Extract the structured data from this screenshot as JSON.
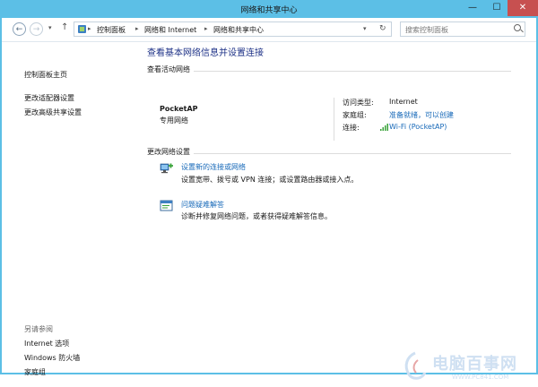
{
  "window": {
    "title": "网络和共享中心"
  },
  "controls": {
    "minimize": "—",
    "maximize": "☐",
    "close": "✕"
  },
  "navbar": {
    "back": "←",
    "forward": "→",
    "dropdown": "▾",
    "up": "↑",
    "breadcrumbs": [
      "控制面板",
      "网络和 Internet",
      "网络和共享中心"
    ],
    "separator": "▸",
    "refresh": "↻",
    "search_placeholder": "搜索控制面板"
  },
  "sidebar": {
    "links": [
      "控制面板主页",
      "更改适配器设置",
      "更改高级共享设置"
    ],
    "see_also_heading": "另请参阅",
    "see_also": [
      "Internet 选项",
      "Windows 防火墙",
      "家庭组"
    ]
  },
  "main": {
    "title": "查看基本网络信息并设置连接",
    "active_networks_heading": "查看活动网络",
    "network": {
      "name": "PocketAP",
      "type": "专用网络",
      "access_type_label": "访问类型:",
      "access_type_value": "Internet",
      "homegroup_label": "家庭组:",
      "homegroup_value": "准备就绪，可以创建",
      "connection_label": "连接:",
      "connection_value": "Wi-Fi (PocketAP)"
    },
    "change_settings_heading": "更改网络设置",
    "tasks": [
      {
        "title": "设置新的连接或网络",
        "description": "设置宽带、拨号或 VPN 连接；或设置路由器或接入点。",
        "icon": "network-setup-icon"
      },
      {
        "title": "问题疑难解答",
        "description": "诊断并修复网络问题，或者获得疑难解答信息。",
        "icon": "troubleshoot-icon"
      }
    ]
  },
  "watermark": {
    "text": "电脑百事网",
    "url": "WWW.PC841.COM"
  },
  "colors": {
    "title_blue": "#1e3287",
    "link_blue": "#1668b8",
    "frame": "#5cbfe6",
    "close_red": "#c75050"
  }
}
